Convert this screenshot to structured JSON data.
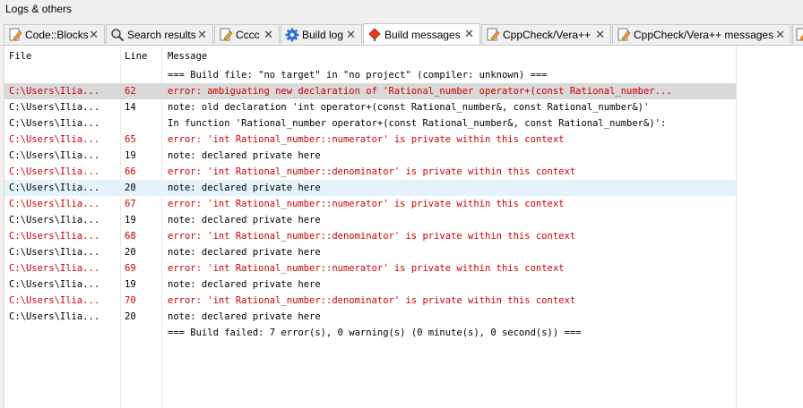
{
  "panel": {
    "title": "Logs & others"
  },
  "tabs": [
    {
      "label": "Code::Blocks",
      "icon": "document-pencil-icon",
      "active": false
    },
    {
      "label": "Search results",
      "icon": "search-icon",
      "active": false
    },
    {
      "label": "Cccc",
      "icon": "document-pencil-icon",
      "active": false
    },
    {
      "label": "Build log",
      "icon": "gear-icon",
      "active": false
    },
    {
      "label": "Build messages",
      "icon": "diamond-pin-icon",
      "active": true
    },
    {
      "label": "CppCheck/Vera++",
      "icon": "document-pencil-icon",
      "active": false
    },
    {
      "label": "CppCheck/Vera++ messages",
      "icon": "document-pencil-icon",
      "active": false
    }
  ],
  "close_glyph": "✕",
  "columns": {
    "file": "File",
    "line": "Line",
    "message": "Message"
  },
  "rows": [
    {
      "file": "",
      "line": "",
      "message": "=== Build file: \"no target\" in \"no project\" (compiler: unknown) ===",
      "type": "info"
    },
    {
      "file": "C:\\Users\\Ilia...",
      "line": "62",
      "message": "error: ambiguating new declaration of 'Rational_number operator+(const Rational_number...",
      "type": "error",
      "state": "selected"
    },
    {
      "file": "C:\\Users\\Ilia...",
      "line": "14",
      "message": "note: old declaration 'int operator+(const Rational_number&, const Rational_number&)'",
      "type": "note"
    },
    {
      "file": "C:\\Users\\Ilia...",
      "line": "",
      "message": "In function 'Rational_number operator+(const Rational_number&, const Rational_number&)':",
      "type": "note"
    },
    {
      "file": "C:\\Users\\Ilia...",
      "line": "65",
      "message": "error: 'int Rational_number::numerator' is private within this context",
      "type": "error"
    },
    {
      "file": "C:\\Users\\Ilia...",
      "line": "19",
      "message": "note: declared private here",
      "type": "note"
    },
    {
      "file": "C:\\Users\\Ilia...",
      "line": "66",
      "message": "error: 'int Rational_number::denominator' is private within this context",
      "type": "error"
    },
    {
      "file": "C:\\Users\\Ilia...",
      "line": "20",
      "message": "note: declared private here",
      "type": "note",
      "state": "hover"
    },
    {
      "file": "C:\\Users\\Ilia...",
      "line": "67",
      "message": "error: 'int Rational_number::numerator' is private within this context",
      "type": "error"
    },
    {
      "file": "C:\\Users\\Ilia...",
      "line": "19",
      "message": "note: declared private here",
      "type": "note"
    },
    {
      "file": "C:\\Users\\Ilia...",
      "line": "68",
      "message": "error: 'int Rational_number::denominator' is private within this context",
      "type": "error"
    },
    {
      "file": "C:\\Users\\Ilia...",
      "line": "20",
      "message": "note: declared private here",
      "type": "note"
    },
    {
      "file": "C:\\Users\\Ilia...",
      "line": "69",
      "message": "error: 'int Rational_number::numerator' is private within this context",
      "type": "error"
    },
    {
      "file": "C:\\Users\\Ilia...",
      "line": "19",
      "message": "note: declared private here",
      "type": "note"
    },
    {
      "file": "C:\\Users\\Ilia...",
      "line": "70",
      "message": "error: 'int Rational_number::denominator' is private within this context",
      "type": "error"
    },
    {
      "file": "C:\\Users\\Ilia...",
      "line": "20",
      "message": "note: declared private here",
      "type": "note"
    },
    {
      "file": "",
      "line": "",
      "message": "=== Build failed: 7 error(s), 0 warning(s) (0 minute(s), 0 second(s)) ===",
      "type": "info"
    }
  ],
  "colors": {
    "error": "#d00000",
    "selected": "#d9d9d9",
    "hover": "#e5f3fb"
  }
}
